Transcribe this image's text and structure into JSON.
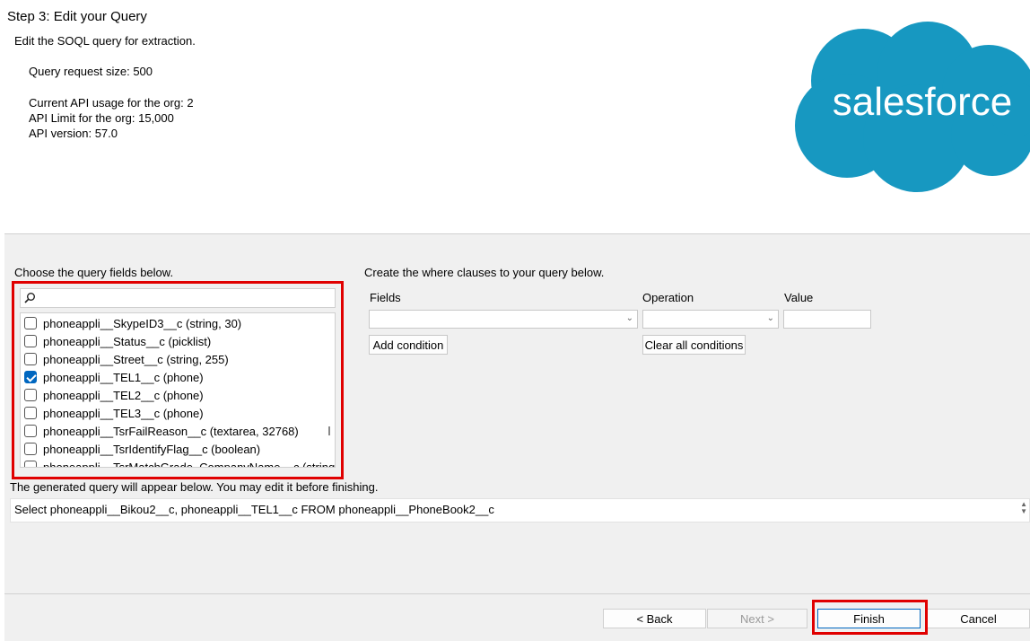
{
  "header": {
    "step_title": "Step 3: Edit your Query",
    "subtitle": "Edit the SOQL query for extraction.",
    "query_request_size": "Query request size: 500",
    "api_usage": "Current API usage for the org: 2",
    "api_limit": "API Limit for the org: 15,000",
    "api_version": "API version: 57.0",
    "logo_text": "salesforce",
    "logo_color": "#1798c1"
  },
  "fields_panel": {
    "label": "Choose the query fields below.",
    "search_icon": "search-icon",
    "search_value": "",
    "items": [
      {
        "label": "phoneappli__SkypeID3__c (string, 30)",
        "checked": false
      },
      {
        "label": "phoneappli__Status__c (picklist)",
        "checked": false
      },
      {
        "label": "phoneappli__Street__c (string, 255)",
        "checked": false
      },
      {
        "label": "phoneappli__TEL1__c (phone)",
        "checked": true
      },
      {
        "label": "phoneappli__TEL2__c (phone)",
        "checked": false
      },
      {
        "label": "phoneappli__TEL3__c (phone)",
        "checked": false
      },
      {
        "label": "phoneappli__TsrFailReason__c (textarea, 32768)",
        "checked": false
      },
      {
        "label": "phoneappli__TsrIdentifyFlag__c (boolean)",
        "checked": false
      },
      {
        "label": "phoneappli__TsrMatchGrade_CompanyName__c (string",
        "checked": false
      }
    ]
  },
  "where_panel": {
    "label": "Create the where clauses to your query below.",
    "fields_label": "Fields",
    "operation_label": "Operation",
    "value_label": "Value",
    "fields_value": "",
    "operation_value": "",
    "value_value": "",
    "add_condition": "Add condition",
    "clear_conditions": "Clear all conditions"
  },
  "query": {
    "label": "The generated query will appear below.  You may edit it before finishing.",
    "text": "Select phoneappli__Bikou2__c, phoneappli__TEL1__c FROM phoneappli__PhoneBook2__c"
  },
  "buttons": {
    "back": "< Back",
    "next": "Next >",
    "finish": "Finish",
    "cancel": "Cancel"
  },
  "colors": {
    "highlight": "#e00000",
    "accent": "#0067c0"
  }
}
